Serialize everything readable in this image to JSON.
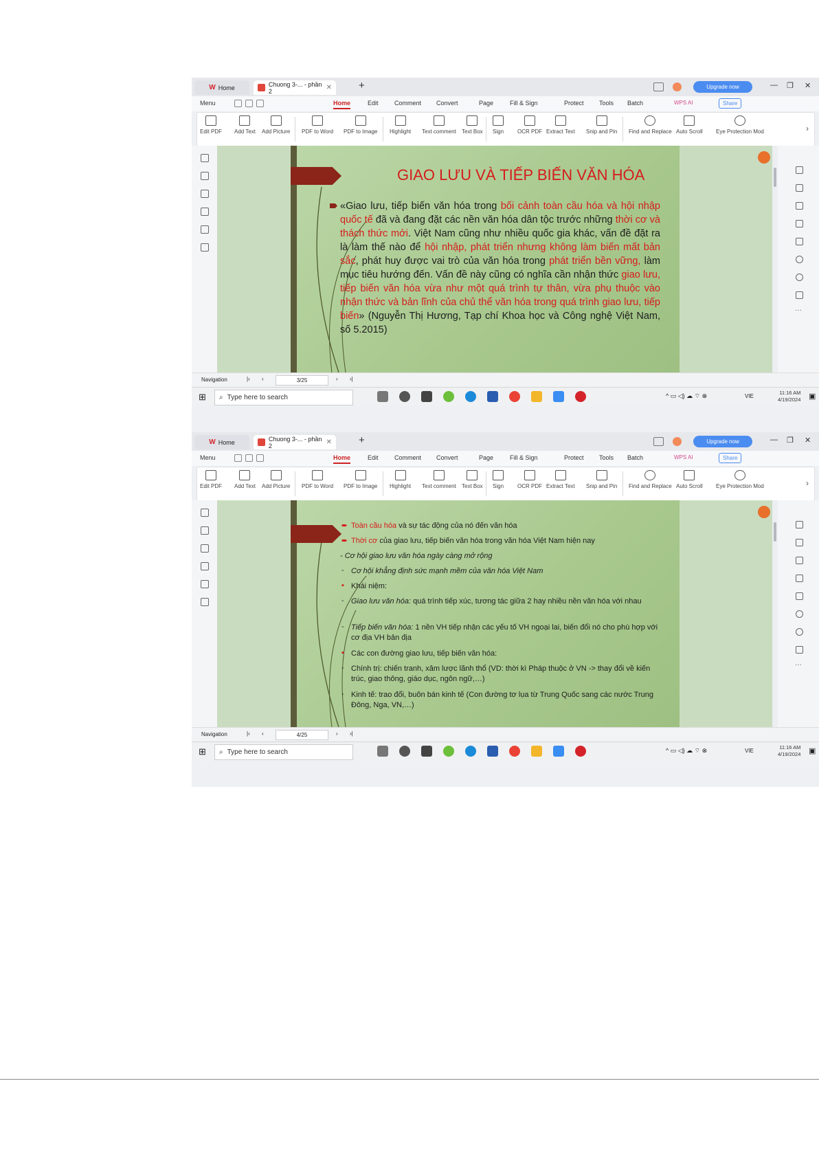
{
  "screens": [
    {
      "tabs": {
        "home": "Home",
        "doc": "Chuong 3-... - phần 2"
      },
      "upgrade": "Upgrade now",
      "menu": [
        "Menu",
        "Home",
        "Edit",
        "Comment",
        "Convert",
        "Page",
        "Fill & Sign",
        "Protect",
        "Tools",
        "Batch"
      ],
      "wps_ai": "WPS AI",
      "share": "Share",
      "ribbon": [
        "Edit PDF",
        "Add Text",
        "Add Picture",
        "PDF to Word",
        "PDF to Image",
        "Highlight",
        "Text comment",
        "Text Box",
        "Sign",
        "OCR PDF",
        "Extract Text",
        "Snip and Pin",
        "Find and Replace",
        "Auto Scroll",
        "Eye Protection Mod"
      ],
      "nav_label": "Navigation",
      "page": "3/25",
      "search": "Type here to search",
      "lang": "VIE",
      "time": "11:16 AM",
      "date": "4/19/2024"
    },
    {
      "tabs": {
        "home": "Home",
        "doc": "Chuong 3-... - phần 2"
      },
      "upgrade": "Upgrade now",
      "menu": [
        "Menu",
        "Home",
        "Edit",
        "Comment",
        "Convert",
        "Page",
        "Fill & Sign",
        "Protect",
        "Tools",
        "Batch"
      ],
      "wps_ai": "WPS AI",
      "share": "Share",
      "ribbon": [
        "Edit PDF",
        "Add Text",
        "Add Picture",
        "PDF to Word",
        "PDF to Image",
        "Highlight",
        "Text comment",
        "Text Box",
        "Sign",
        "OCR PDF",
        "Extract Text",
        "Snip and Pin",
        "Find and Replace",
        "Auto Scroll",
        "Eye Protection Mod"
      ],
      "nav_label": "Navigation",
      "page": "4/25",
      "search": "Type here to search",
      "lang": "VIE",
      "time": "11:16 AM",
      "date": "4/19/2024"
    }
  ],
  "slide1": {
    "title": "GIAO LƯU VÀ TIẾP BIẾN VĂN HÓA",
    "p": [
      "«Giao lưu, tiếp biến văn hóa trong ",
      "bối cảnh toàn cầu hóa và hội nhập quốc tế",
      " đã và đang đặt các nền văn hóa dân tộc trước những ",
      "thời cơ và thách thức mới",
      ". Việt Nam cũng như nhiều quốc gia khác, vấn đề đặt ra là làm thế nào để ",
      "hội nhập, phát triển nhưng không làm biến mất bản sắc",
      ", phát huy được vai trò của văn hóa trong ",
      "phát triển bền vững,",
      " làm mục tiêu hướng đến. Vấn đề này cũng có nghĩa cần nhận thức ",
      "giao lưu, tiếp biến văn hóa vừa như một quá trình tự thân, vừa phụ thuộc vào nhận thức và bản lĩnh của chủ thể văn hóa trong quá trình giao lưu, tiếp biến",
      "» (Nguyễn Thị Hương, Tạp chí Khoa học và Công nghệ Việt Nam, số 5.2015)"
    ]
  },
  "slide2": {
    "l1_red": "Toàn cầu hóa",
    "l1_rest": " và sự tác động của nó đến văn hóa",
    "l2_red": "Thời cơ",
    "l2_rest": " của giao lưu, tiếp biến văn hóa trong văn hóa Việt Nam hiện nay",
    "l3": "- Cơ hội giao lưu văn hóa ngày càng mở rộng",
    "l4": "Cơ hội khẳng định sức mạnh mềm của văn hóa Việt Nam",
    "l5": "Khái niệm:",
    "l6_i": "Giao lưu văn hóa:",
    "l6_rest": " quá trình tiếp xúc, tương tác giữa 2 hay nhiều nền văn hóa với nhau",
    "l7_i": "Tiếp biến văn hóa:",
    "l7_rest": " 1 nền VH tiếp nhận các yếu tố VH ngoại lai, biến đổi nó cho phù hợp với cơ địa VH bản địa",
    "l8": "Các con đường giao lưu, tiếp biến văn hóa:",
    "l9": "Chính trị: chiến tranh, xâm lược lãnh thổ (VD: thời kì Pháp thuộc ở VN -> thay đổi về kiến trúc, giao thông, giáo dục, ngôn ngữ,…)",
    "l10": "Kinh tế: trao đổi, buôn bán kinh tế (Con đường tơ lụa từ Trung Quốc sang các nước Trung Đông, Nga, VN,…)"
  },
  "colors": {
    "accent": "#d51c1c",
    "slide_green": "#a9c98f",
    "arrow": "#8b2519",
    "upgrade": "#4b8cf0"
  }
}
